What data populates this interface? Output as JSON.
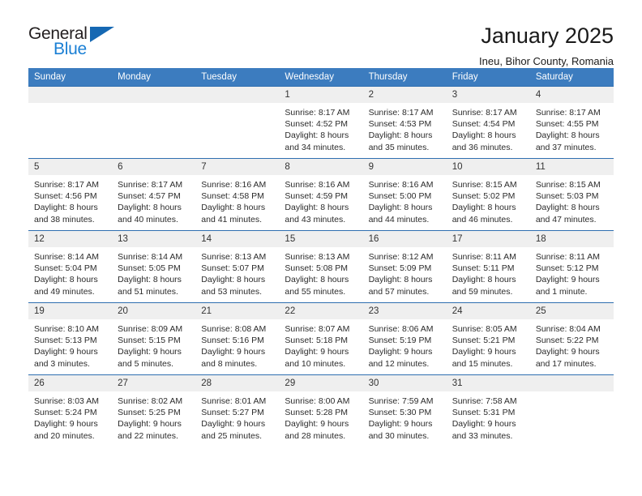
{
  "brand": {
    "name_top": "General",
    "name_bottom": "Blue",
    "accent_color": "#1668b3",
    "text_color": "#231f20"
  },
  "header": {
    "title": "January 2025",
    "subtitle": "Ineu, Bihor County, Romania"
  },
  "theme": {
    "header_row_bg": "#3c7cbf",
    "cell_border": "#2f6fb0",
    "daynum_band_bg": "#efefef"
  },
  "weekday_headers": [
    "Sunday",
    "Monday",
    "Tuesday",
    "Wednesday",
    "Thursday",
    "Friday",
    "Saturday"
  ],
  "weeks": [
    [
      {
        "day": "",
        "empty": true
      },
      {
        "day": "",
        "empty": true
      },
      {
        "day": "",
        "empty": true
      },
      {
        "day": "1",
        "sunrise": "Sunrise: 8:17 AM",
        "sunset": "Sunset: 4:52 PM",
        "daylight1": "Daylight: 8 hours",
        "daylight2": "and 34 minutes."
      },
      {
        "day": "2",
        "sunrise": "Sunrise: 8:17 AM",
        "sunset": "Sunset: 4:53 PM",
        "daylight1": "Daylight: 8 hours",
        "daylight2": "and 35 minutes."
      },
      {
        "day": "3",
        "sunrise": "Sunrise: 8:17 AM",
        "sunset": "Sunset: 4:54 PM",
        "daylight1": "Daylight: 8 hours",
        "daylight2": "and 36 minutes."
      },
      {
        "day": "4",
        "sunrise": "Sunrise: 8:17 AM",
        "sunset": "Sunset: 4:55 PM",
        "daylight1": "Daylight: 8 hours",
        "daylight2": "and 37 minutes."
      }
    ],
    [
      {
        "day": "5",
        "sunrise": "Sunrise: 8:17 AM",
        "sunset": "Sunset: 4:56 PM",
        "daylight1": "Daylight: 8 hours",
        "daylight2": "and 38 minutes."
      },
      {
        "day": "6",
        "sunrise": "Sunrise: 8:17 AM",
        "sunset": "Sunset: 4:57 PM",
        "daylight1": "Daylight: 8 hours",
        "daylight2": "and 40 minutes."
      },
      {
        "day": "7",
        "sunrise": "Sunrise: 8:16 AM",
        "sunset": "Sunset: 4:58 PM",
        "daylight1": "Daylight: 8 hours",
        "daylight2": "and 41 minutes."
      },
      {
        "day": "8",
        "sunrise": "Sunrise: 8:16 AM",
        "sunset": "Sunset: 4:59 PM",
        "daylight1": "Daylight: 8 hours",
        "daylight2": "and 43 minutes."
      },
      {
        "day": "9",
        "sunrise": "Sunrise: 8:16 AM",
        "sunset": "Sunset: 5:00 PM",
        "daylight1": "Daylight: 8 hours",
        "daylight2": "and 44 minutes."
      },
      {
        "day": "10",
        "sunrise": "Sunrise: 8:15 AM",
        "sunset": "Sunset: 5:02 PM",
        "daylight1": "Daylight: 8 hours",
        "daylight2": "and 46 minutes."
      },
      {
        "day": "11",
        "sunrise": "Sunrise: 8:15 AM",
        "sunset": "Sunset: 5:03 PM",
        "daylight1": "Daylight: 8 hours",
        "daylight2": "and 47 minutes."
      }
    ],
    [
      {
        "day": "12",
        "sunrise": "Sunrise: 8:14 AM",
        "sunset": "Sunset: 5:04 PM",
        "daylight1": "Daylight: 8 hours",
        "daylight2": "and 49 minutes."
      },
      {
        "day": "13",
        "sunrise": "Sunrise: 8:14 AM",
        "sunset": "Sunset: 5:05 PM",
        "daylight1": "Daylight: 8 hours",
        "daylight2": "and 51 minutes."
      },
      {
        "day": "14",
        "sunrise": "Sunrise: 8:13 AM",
        "sunset": "Sunset: 5:07 PM",
        "daylight1": "Daylight: 8 hours",
        "daylight2": "and 53 minutes."
      },
      {
        "day": "15",
        "sunrise": "Sunrise: 8:13 AM",
        "sunset": "Sunset: 5:08 PM",
        "daylight1": "Daylight: 8 hours",
        "daylight2": "and 55 minutes."
      },
      {
        "day": "16",
        "sunrise": "Sunrise: 8:12 AM",
        "sunset": "Sunset: 5:09 PM",
        "daylight1": "Daylight: 8 hours",
        "daylight2": "and 57 minutes."
      },
      {
        "day": "17",
        "sunrise": "Sunrise: 8:11 AM",
        "sunset": "Sunset: 5:11 PM",
        "daylight1": "Daylight: 8 hours",
        "daylight2": "and 59 minutes."
      },
      {
        "day": "18",
        "sunrise": "Sunrise: 8:11 AM",
        "sunset": "Sunset: 5:12 PM",
        "daylight1": "Daylight: 9 hours",
        "daylight2": "and 1 minute."
      }
    ],
    [
      {
        "day": "19",
        "sunrise": "Sunrise: 8:10 AM",
        "sunset": "Sunset: 5:13 PM",
        "daylight1": "Daylight: 9 hours",
        "daylight2": "and 3 minutes."
      },
      {
        "day": "20",
        "sunrise": "Sunrise: 8:09 AM",
        "sunset": "Sunset: 5:15 PM",
        "daylight1": "Daylight: 9 hours",
        "daylight2": "and 5 minutes."
      },
      {
        "day": "21",
        "sunrise": "Sunrise: 8:08 AM",
        "sunset": "Sunset: 5:16 PM",
        "daylight1": "Daylight: 9 hours",
        "daylight2": "and 8 minutes."
      },
      {
        "day": "22",
        "sunrise": "Sunrise: 8:07 AM",
        "sunset": "Sunset: 5:18 PM",
        "daylight1": "Daylight: 9 hours",
        "daylight2": "and 10 minutes."
      },
      {
        "day": "23",
        "sunrise": "Sunrise: 8:06 AM",
        "sunset": "Sunset: 5:19 PM",
        "daylight1": "Daylight: 9 hours",
        "daylight2": "and 12 minutes."
      },
      {
        "day": "24",
        "sunrise": "Sunrise: 8:05 AM",
        "sunset": "Sunset: 5:21 PM",
        "daylight1": "Daylight: 9 hours",
        "daylight2": "and 15 minutes."
      },
      {
        "day": "25",
        "sunrise": "Sunrise: 8:04 AM",
        "sunset": "Sunset: 5:22 PM",
        "daylight1": "Daylight: 9 hours",
        "daylight2": "and 17 minutes."
      }
    ],
    [
      {
        "day": "26",
        "sunrise": "Sunrise: 8:03 AM",
        "sunset": "Sunset: 5:24 PM",
        "daylight1": "Daylight: 9 hours",
        "daylight2": "and 20 minutes."
      },
      {
        "day": "27",
        "sunrise": "Sunrise: 8:02 AM",
        "sunset": "Sunset: 5:25 PM",
        "daylight1": "Daylight: 9 hours",
        "daylight2": "and 22 minutes."
      },
      {
        "day": "28",
        "sunrise": "Sunrise: 8:01 AM",
        "sunset": "Sunset: 5:27 PM",
        "daylight1": "Daylight: 9 hours",
        "daylight2": "and 25 minutes."
      },
      {
        "day": "29",
        "sunrise": "Sunrise: 8:00 AM",
        "sunset": "Sunset: 5:28 PM",
        "daylight1": "Daylight: 9 hours",
        "daylight2": "and 28 minutes."
      },
      {
        "day": "30",
        "sunrise": "Sunrise: 7:59 AM",
        "sunset": "Sunset: 5:30 PM",
        "daylight1": "Daylight: 9 hours",
        "daylight2": "and 30 minutes."
      },
      {
        "day": "31",
        "sunrise": "Sunrise: 7:58 AM",
        "sunset": "Sunset: 5:31 PM",
        "daylight1": "Daylight: 9 hours",
        "daylight2": "and 33 minutes."
      },
      {
        "day": "",
        "empty": true
      }
    ]
  ]
}
